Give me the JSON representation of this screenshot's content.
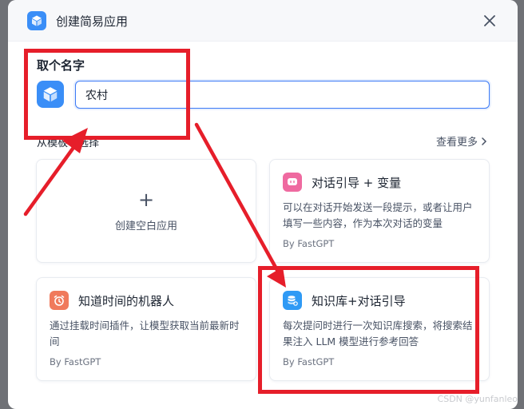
{
  "header": {
    "title": "创建简易应用"
  },
  "name_section": {
    "title": "取个名字",
    "input_value": "农村"
  },
  "templates": {
    "label": "从模板中选择",
    "see_more": "查看更多",
    "empty_card": {
      "label": "创建空白应用"
    },
    "cards": [
      {
        "title": "对话引导 + 变量",
        "desc": "可以在对话开始发送一段提示，或者让用户填写一些内容，作为本次对话的变量",
        "author": "By FastGPT",
        "icon": "chat-guide-icon",
        "icon_color": "#ef6aa0"
      },
      {
        "title": "知道时间的机器人",
        "desc": "通过挂载时间插件，让模型获取当前最新时间",
        "author": "By FastGPT",
        "icon": "alarm-clock-icon",
        "icon_color": "#f07a5c"
      },
      {
        "title": "知识库+对话引导",
        "desc": "每次提问时进行一次知识库搜索，将搜索结果注入 LLM 模型进行参考回答",
        "author": "By FastGPT",
        "icon": "knowledge-base-icon",
        "icon_color": "#2f9af5"
      }
    ]
  },
  "watermark": "CSDN @yunfanleo",
  "colors": {
    "brand": "#3a8ef7",
    "input_border": "#3c7af5",
    "annotation": "#e61e2a"
  }
}
